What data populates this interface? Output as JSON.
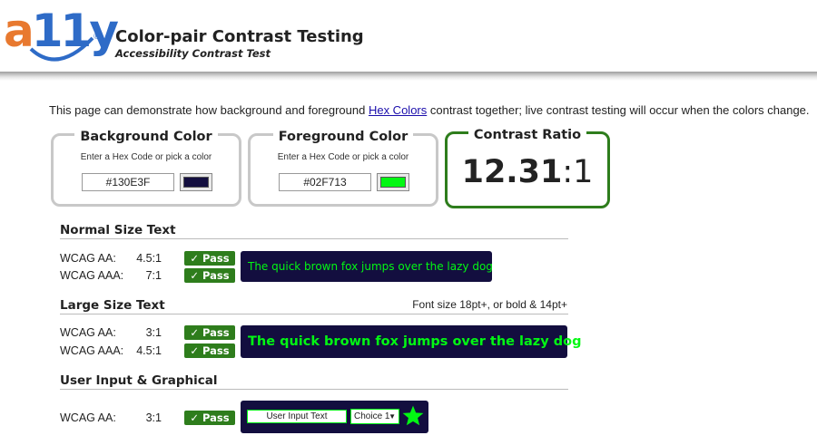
{
  "header": {
    "logo": "a11y",
    "logo_mark": "®",
    "title": "Color-pair Contrast Testing",
    "subtitle": "Accessibility Contrast Test"
  },
  "intro": {
    "before": "This page can demonstrate how background and foreground ",
    "link": "Hex Colors",
    "after": " contrast together; live contrast testing will occur when the colors change."
  },
  "background": {
    "title": "Background Color",
    "hint": "Enter a Hex Code or pick a color",
    "value": "#130E3F",
    "color": "#130E3F"
  },
  "foreground": {
    "title": "Foreground Color",
    "hint": "Enter a Hex Code or pick a color",
    "value": "#02F713",
    "color": "#02F713"
  },
  "ratio": {
    "title": "Contrast Ratio",
    "value": "12.31",
    "separator": ":",
    "denominator": "1",
    "border_color": "#2e7d1c"
  },
  "normal": {
    "title": "Normal Size Text",
    "rows": [
      {
        "label": "WCAG AA:",
        "ratio": "4.5:1",
        "result": "✓ Pass"
      },
      {
        "label": "WCAG AAA:",
        "ratio": "7:1",
        "result": "✓ Pass"
      }
    ],
    "sample": "The quick brown fox jumps over the lazy dog"
  },
  "large": {
    "title": "Large Size Text",
    "note": "Font size 18pt+, or bold & 14pt+",
    "rows": [
      {
        "label": "WCAG AA:",
        "ratio": "3:1",
        "result": "✓ Pass"
      },
      {
        "label": "WCAG AAA:",
        "ratio": "4.5:1",
        "result": "✓ Pass"
      }
    ],
    "sample": "The quick brown fox jumps over the lazy dog"
  },
  "graphical": {
    "title": "User Input & Graphical",
    "rows": [
      {
        "label": "WCAG AA:",
        "ratio": "3:1",
        "result": "✓ Pass"
      }
    ],
    "input_text": "User Input Text",
    "select_value": "Choice 1",
    "star_icon": "star-icon"
  },
  "colors": {
    "pass": "#2e7d1c",
    "link": "#1a0dab",
    "logo_orange": "#e8792f",
    "logo_blue": "#2e6bc7"
  }
}
